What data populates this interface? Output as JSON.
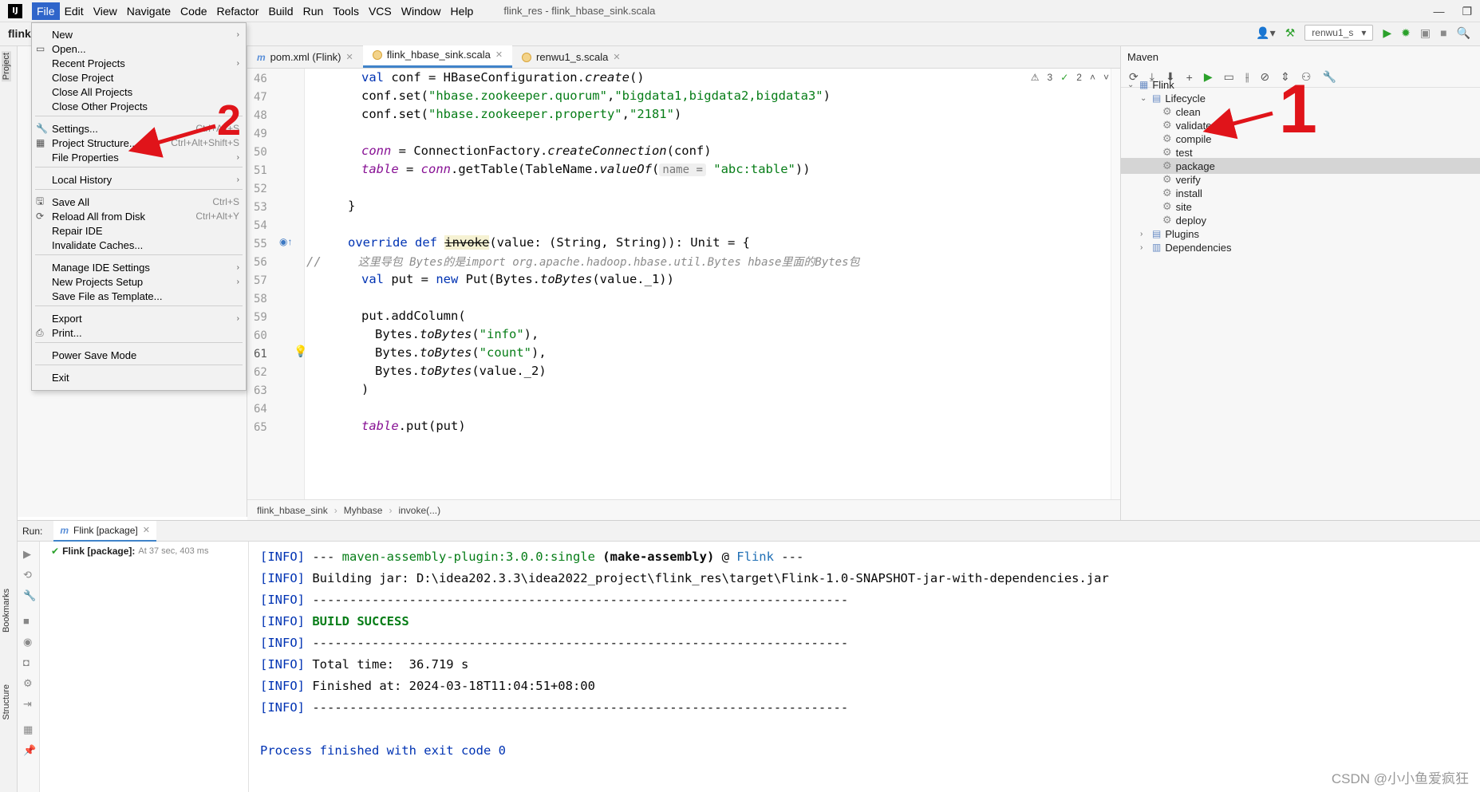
{
  "menubar": {
    "items": [
      "File",
      "Edit",
      "View",
      "Navigate",
      "Code",
      "Refactor",
      "Build",
      "Run",
      "Tools",
      "VCS",
      "Window",
      "Help"
    ],
    "window_title": "flink_res - flink_hbase_sink.scala"
  },
  "toolbar": {
    "project_name": "flink",
    "run_config": "renwu1_s"
  },
  "side_tabs": {
    "project": "Project",
    "bookmarks": "Bookmarks",
    "structure": "Structure"
  },
  "editor": {
    "tabs": [
      {
        "label": "pom.xml (Flink)",
        "icon": "maven-icon"
      },
      {
        "label": "flink_hbase_sink.scala",
        "icon": "scala-object-icon"
      },
      {
        "label": "renwu1_s.scala",
        "icon": "scala-object-icon"
      }
    ],
    "warnings_count": "3",
    "weak_warnings_count": "2",
    "line_numbers": [
      "46",
      "47",
      "48",
      "49",
      "50",
      "51",
      "52",
      "53",
      "54",
      "55",
      "56",
      "57",
      "58",
      "59",
      "60",
      "61",
      "62",
      "63",
      "64",
      "65"
    ],
    "param_hint": "name =",
    "code": {
      "l46_kw": "val",
      "l46_rest": " conf = HBaseConfiguration.",
      "l46_call": "create",
      "l46_end": "()",
      "l47_a": "conf.set(",
      "l47_s1": "\"hbase.zookeeper.quorum\"",
      "l47_s2": "\"bigdata1,bigdata2,bigdata3\"",
      "l48_a": "conf.set(",
      "l48_s1": "\"hbase.zookeeper.property\"",
      "l48_s2": "\"2181\"",
      "l50_f": "conn",
      "l50_rest": " = ConnectionFactory.",
      "l50_call": "createConnection",
      "l50_end": "(conf)",
      "l51_f": "table",
      "l51_a": " = ",
      "l51_f2": "conn",
      "l51_b": ".getTable(TableName.",
      "l51_call": "valueOf",
      "l51_c": "(",
      "l51_s": "\"abc:table\"",
      "l51_end": "))",
      "l53": "}",
      "l55_kw": "override def",
      "l55_fn": "invoke",
      "l55_rest": "(value: (String, String)): Unit = {",
      "l56_marker": "//",
      "l56_comment": "这里导包 Bytes的是import org.apache.hadoop.hbase.util.Bytes hbase里面的Bytes包",
      "l57_kw": "val",
      "l57_a": " put = ",
      "l57_kw2": "new",
      "l57_b": " Put(Bytes.",
      "l57_call": "toBytes",
      "l57_end": "(value._1))",
      "l59": "put.addColumn(",
      "l60_a": "Bytes.",
      "l60_call": "toBytes",
      "l60_s": "\"info\"",
      "l61_a": "Bytes.",
      "l61_call": "toBytes",
      "l61_s": "\"count\"",
      "l62_a": "Bytes.",
      "l62_call": "toBytes",
      "l62_end": "(value._2)",
      "l63": ")",
      "l65_f": "table",
      "l65_rest": ".put(put)"
    },
    "breadcrumb": [
      "flink_hbase_sink",
      "Myhbase",
      "invoke(...)"
    ]
  },
  "file_menu": {
    "items": [
      {
        "label": "New",
        "shortcut": "",
        "submenu": true
      },
      {
        "label": "Open...",
        "shortcut": "",
        "submenu": false
      },
      {
        "label": "Recent Projects",
        "shortcut": "",
        "submenu": true
      },
      {
        "label": "Close Project",
        "shortcut": "",
        "submenu": false
      },
      {
        "label": "Close All Projects",
        "shortcut": "",
        "submenu": false
      },
      {
        "label": "Close Other Projects",
        "shortcut": "",
        "submenu": false
      },
      {
        "label": "Settings...",
        "shortcut": "Ctrl+Alt+S",
        "submenu": false
      },
      {
        "label": "Project Structure...",
        "shortcut": "Ctrl+Alt+Shift+S",
        "submenu": false
      },
      {
        "label": "File Properties",
        "shortcut": "",
        "submenu": true
      },
      {
        "label": "Local History",
        "shortcut": "",
        "submenu": true
      },
      {
        "label": "Save All",
        "shortcut": "Ctrl+S",
        "submenu": false
      },
      {
        "label": "Reload All from Disk",
        "shortcut": "Ctrl+Alt+Y",
        "submenu": false
      },
      {
        "label": "Repair IDE",
        "shortcut": "",
        "submenu": false
      },
      {
        "label": "Invalidate Caches...",
        "shortcut": "",
        "submenu": false
      },
      {
        "label": "Manage IDE Settings",
        "shortcut": "",
        "submenu": true
      },
      {
        "label": "New Projects Setup",
        "shortcut": "",
        "submenu": true
      },
      {
        "label": "Save File as Template...",
        "shortcut": "",
        "submenu": false
      },
      {
        "label": "Export",
        "shortcut": "",
        "submenu": true
      },
      {
        "label": "Print...",
        "shortcut": "",
        "submenu": false
      },
      {
        "label": "Power Save Mode",
        "shortcut": "",
        "submenu": false
      },
      {
        "label": "Exit",
        "shortcut": "",
        "submenu": false
      }
    ]
  },
  "maven": {
    "title": "Maven",
    "root": "Flink",
    "lifecycle_label": "Lifecycle",
    "lifecycle": [
      "clean",
      "validate",
      "compile",
      "test",
      "package",
      "verify",
      "install",
      "site",
      "deploy"
    ],
    "selected": "package",
    "plugins": "Plugins",
    "dependencies": "Dependencies"
  },
  "run": {
    "label": "Run:",
    "tab": "Flink [package]",
    "tree_item_name": "Flink [package]:",
    "tree_item_time": "At 37 sec, 403 ms",
    "console": {
      "tag": "[INFO]",
      "l1_a": " --- ",
      "l1_plugin": "maven-assembly-plugin:3.0.0:single",
      "l1_b": " ",
      "l1_goal": "(make-assembly)",
      "l1_c": " @ ",
      "l1_proj": "Flink",
      "l1_d": " ---",
      "l2": " Building jar: D:\\idea202.3.3\\idea2022_project\\flink_res\\target\\Flink-1.0-SNAPSHOT-jar-with-dependencies.jar",
      "dashes": " ------------------------------------------------------------------------",
      "success": "BUILD SUCCESS",
      "total_time": " Total time:  36.719 s",
      "finished": " Finished at: 2024-03-18T11:04:51+08:00",
      "exit": "Process finished with exit code 0"
    }
  },
  "annotations": {
    "num1": "1",
    "num2": "2",
    "color": "#e0141a"
  },
  "watermark": "CSDN @小小鱼爱疯狂"
}
